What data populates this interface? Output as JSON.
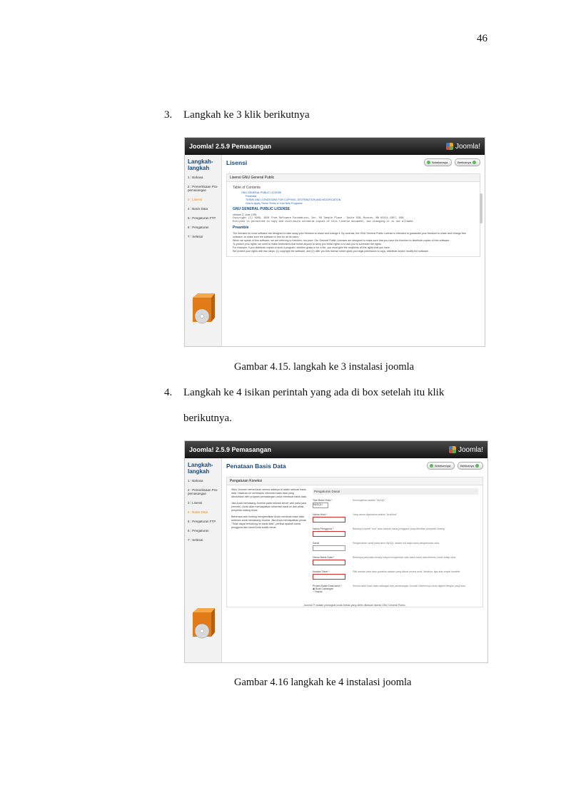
{
  "page_number": "46",
  "steps": [
    {
      "num": "3.",
      "text": "Langkah ke 3 klik berikutnya"
    },
    {
      "num": "4.",
      "text_line1": "Langkah ke 4 isikan perintah yang ada di box setelah itu klik",
      "text_line2": "berikutnya."
    }
  ],
  "captions": {
    "fig1": "Gambar 4.15. langkah ke 3 instalasi joomla",
    "fig2": "Gambar 4.16 langkah ke 4 instalasi joomla"
  },
  "shot1": {
    "title": "Joomla! 2.5.9 Pemasangan",
    "logo": "Joomla!",
    "side_heading": "Langkah-langkah",
    "side_items": [
      "1 : Bahasa",
      "2 : Pemeriksaan Pra-pemasangan",
      "3 : Lisensi",
      "4 : Basis Data",
      "5 : Pengaturan FTP",
      "6 : Pengaturan",
      "7 : Selesai"
    ],
    "active_index": 2,
    "heading": "Lisensi",
    "btn_prev": "Sebelumnya",
    "btn_next": "Berikutnya",
    "panel_title": "Lisensi GNU General Public",
    "toc_title": "Table of Contents",
    "toc": [
      "GNU GENERAL PUBLIC LICENSE",
      "Preamble",
      "TERMS AND CONDITIONS FOR COPYING, DISTRIBUTION AND MODIFICATION",
      "How to Apply These Terms to Your New Programs"
    ],
    "license_title": "GNU GENERAL PUBLIC LICENSE",
    "version": "Version 2, June 1991",
    "copyright": "Copyright (C) 1989, 1991 Free Software Foundation, Inc. 59 Temple Place - Suite 330, Boston, MA 02111-1307, USA",
    "everyone": "Everyone is permitted to copy and distribute verbatim copies of this license document, but changing it is not allowed.",
    "preamble": "Preamble",
    "p1": "The licenses for most software are designed to take away your freedom to share and change it. By contrast, the GNU General Public License is intended to guarantee your freedom to share and change free software--to make sure the software is free for all its users.",
    "p2": "When we speak of free software, we are referring to freedom, not price. Our General Public Licenses are designed to make sure that you have the freedom to distribute copies of free software.",
    "p3": "To protect your rights, we need to make restrictions that forbid anyone to deny you these rights or to ask you to surrender the rights.",
    "p4": "For example, if you distribute copies of such a program, whether gratis or for a fee, you must give the recipients all the rights that you have.",
    "p5": "We protect your rights with two steps: (1) copyright the software, and (2) offer you this license which gives you legal permission to copy, distribute and/or modify the software."
  },
  "shot2": {
    "title": "Joomla! 2.5.9 Pemasangan",
    "logo": "Joomla!",
    "side_heading": "Langkah-langkah",
    "side_items": [
      "1 : Bahasa",
      "2 : Pemeriksaan Pra-pemasangan",
      "3 : Lisensi",
      "4 : Basis Data",
      "5 : Pengaturan FTP",
      "6 : Pengaturan",
      "7 : Selesai"
    ],
    "active_index": 3,
    "heading": "Penataan Basis Data",
    "btn_prev": "Sebelumnya",
    "btn_next": "Berikutnya",
    "panel_title": "Pengaturan Koneksi",
    "intro1": "Situs Joomla! memerlukan semua datanya di dalam sebuah basis data. Halaman ini membantu informasi basis data yang dibutuhkan oleh program pemasangan untuk membuat basis data.",
    "intro2": "Jika Anda memasang Joomla! pada sebuah server web pada jasa (remote), Anda akan mendapatkan informasi basis ini dari pihak penyedia hosting Anda.",
    "intro3": "Beberapa web hosting menghentikan Anda membuat basis data sebelum anda memasang Joomla. Jika Anda mendapatkan pesan \"Tidak dapat terhubung ke basis data\", periksa apakah nama pengguna dan sandi Anda sudah benar.",
    "settings_title": "Pengaturan Dasar",
    "fields": [
      {
        "label": "Tipe Basis Data *",
        "value": "MySQLi",
        "help": "Kemungkinan adalah \"MySQL\"",
        "req": false
      },
      {
        "label": "Nama Host *",
        "value": "",
        "help": "Yang umum digunakan adalah \"localhost\"",
        "req": true
      },
      {
        "label": "Nama Pengguna *",
        "value": "",
        "help": "Biasanya seperti \"root\" atau sebuah nama pengguna yang diberikan penyedia hosting",
        "req": true
      },
      {
        "label": "Sandi",
        "value": "",
        "help": "Pengamanan sandi pada akun MySQL adalah hal wajib untuk pengamanan situs",
        "req": false
      },
      {
        "label": "Nama Basis Data *",
        "value": "",
        "help": "Beberapa penyedia hosting hanya mengizinkan satu nama basis data tertentu untuk setiap situs.",
        "req": true
      },
      {
        "label": "Awalan Tabel *",
        "value": "",
        "help": "Pilih awalan tabel atau gunakan awalan yang dibuat secara acak. Idealnya, tiga atau empat karakter.",
        "req": true
      }
    ],
    "old_db_label": "Proses Basis Data lama *",
    "opt_backup": "Buat Cadangan",
    "opt_delete": "Hapus",
    "old_db_help": "Semua tabel basis data cadangan dari pemasangan Joomla! sebelumnya akan diganti dengan yang baru.",
    "footer": "Joomla! ® adalah perangkat lunak bebas yang dirilis dibawah lisensi GNU General Public."
  }
}
